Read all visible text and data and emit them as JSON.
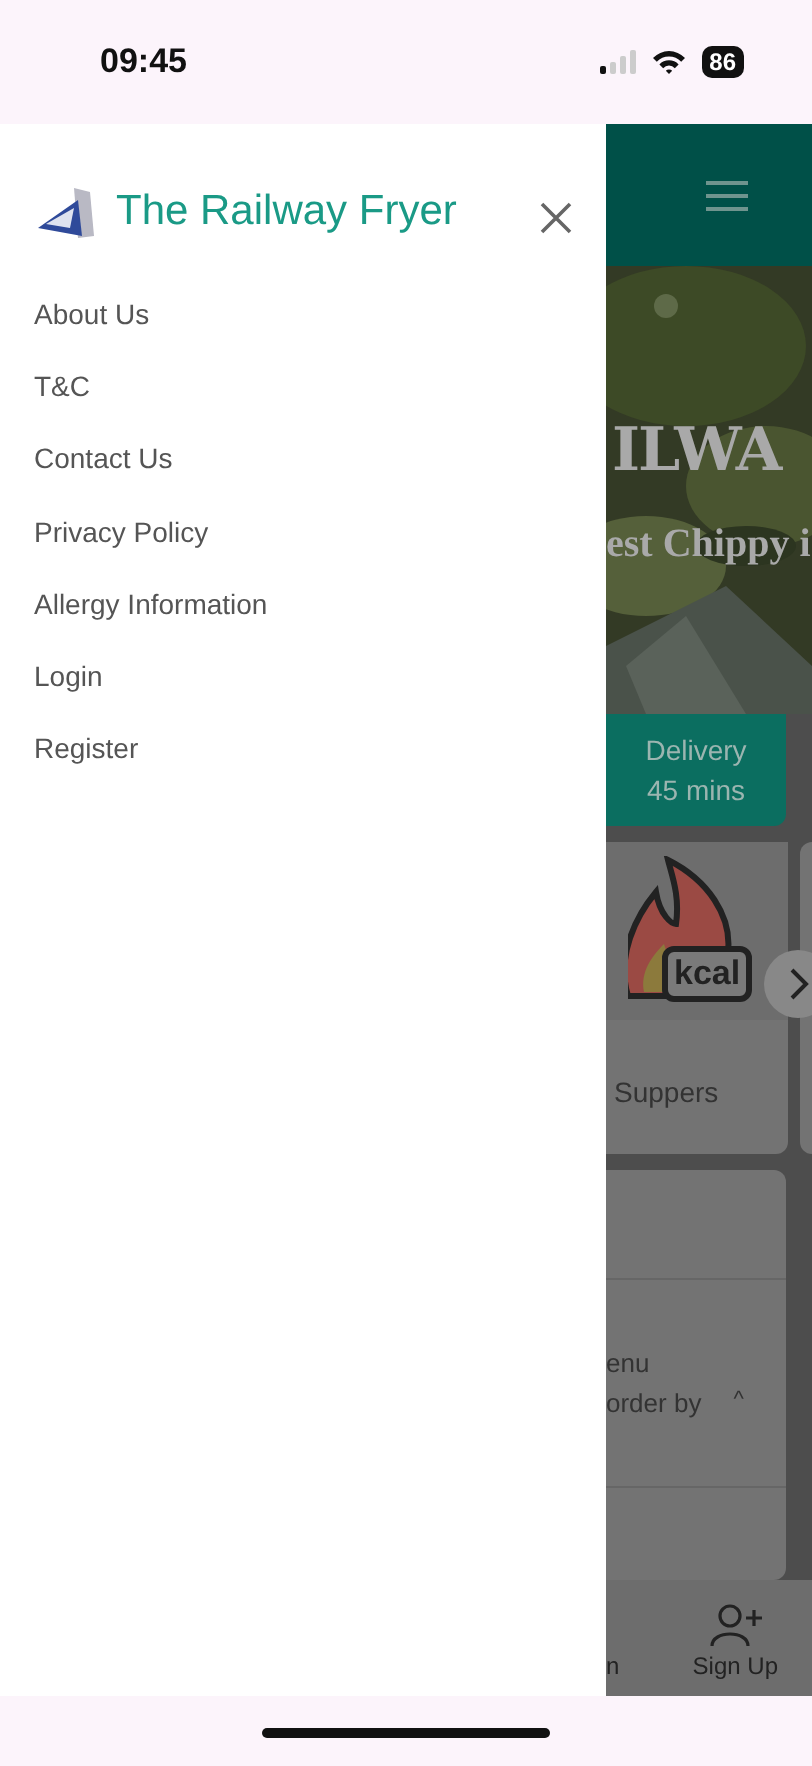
{
  "status_bar": {
    "time": "09:45",
    "battery": "86"
  },
  "drawer": {
    "brand": "The Railway Fryer",
    "items": [
      {
        "label": "About Us"
      },
      {
        "label": "T&C"
      },
      {
        "label": "Contact Us"
      },
      {
        "label": "Privacy Policy"
      },
      {
        "label": "Allergy Information"
      },
      {
        "label": "Login"
      },
      {
        "label": "Register"
      }
    ]
  },
  "background": {
    "hero": {
      "title": "ILWA",
      "subtitle": "est Chippy i"
    },
    "delivery": {
      "label": "Delivery",
      "value": "45 mins"
    },
    "category": {
      "label": "Suppers",
      "badge": "kcal"
    },
    "menu_panel": {
      "lines": [
        "enu",
        "order by"
      ],
      "toggle": "^"
    },
    "bottom_nav": [
      {
        "label": "n",
        "kind": "text"
      },
      {
        "label": "Sign Up",
        "kind": "signup"
      }
    ]
  }
}
